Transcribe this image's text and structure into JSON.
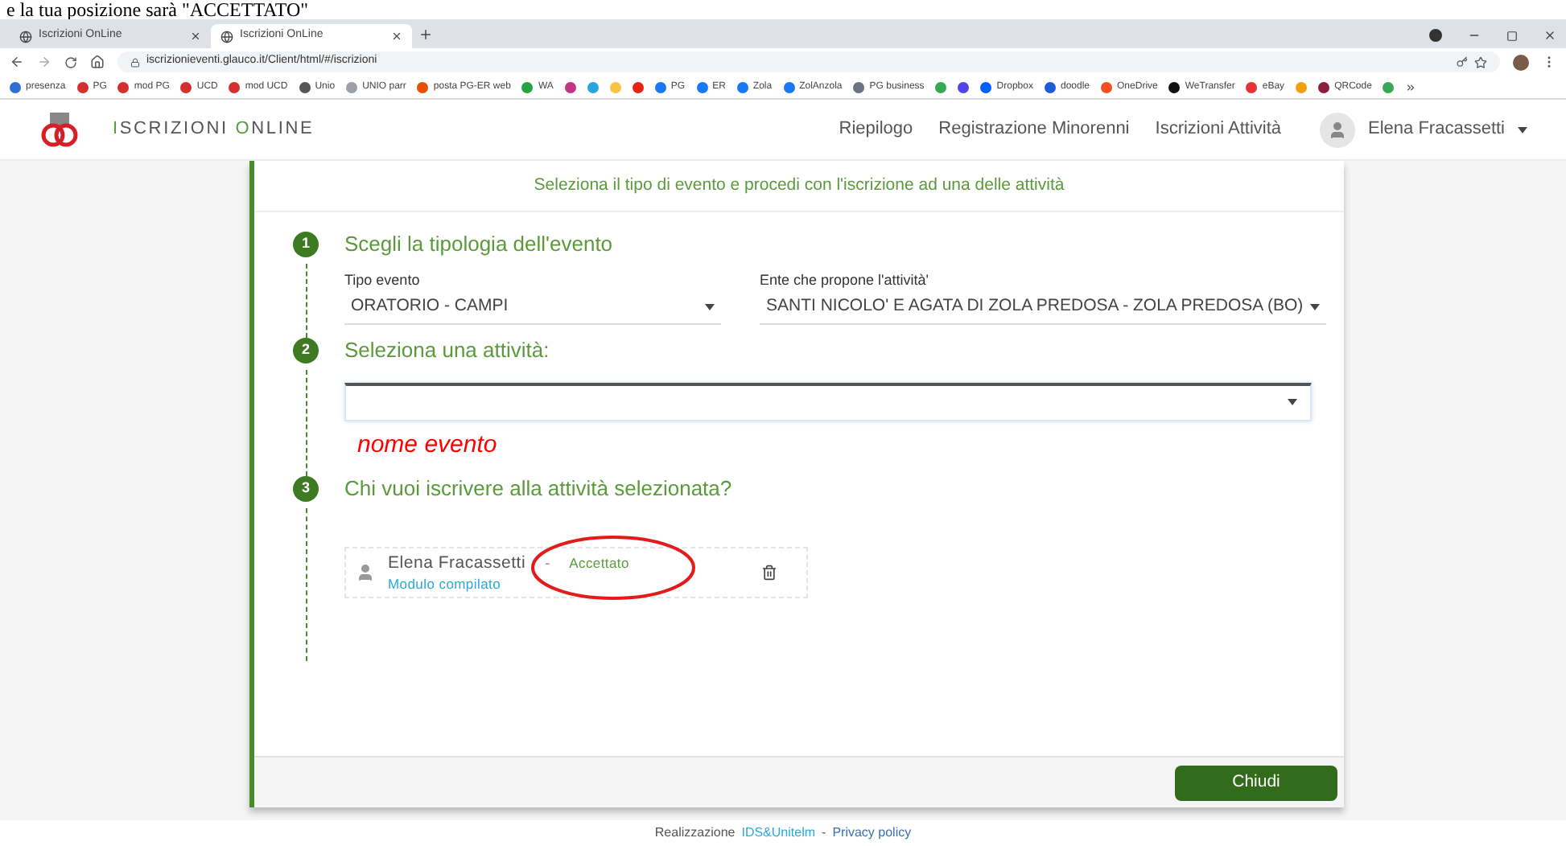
{
  "caption": "e la tua posizione sarà \"ACCETTATO\"",
  "browser": {
    "tabs": [
      {
        "title": "Iscrizioni OnLine",
        "selected": false
      },
      {
        "title": "Iscrizioni OnLine",
        "selected": true
      }
    ],
    "url": "iscrizionieventi.glauco.it/Client/html/#/iscrizioni",
    "bookmarks": [
      {
        "label": "presenza",
        "color": "#2f6fd1"
      },
      {
        "label": "PG",
        "color": "#d32f2f"
      },
      {
        "label": "mod PG",
        "color": "#d32f2f"
      },
      {
        "label": "UCD",
        "color": "#d32f2f"
      },
      {
        "label": "mod UCD",
        "color": "#d32f2f"
      },
      {
        "label": "Unio",
        "color": "#555555"
      },
      {
        "label": "UNIO parr",
        "color": "#9aa0a6"
      },
      {
        "label": "posta PG-ER web",
        "color": "#e65100"
      },
      {
        "label": "WA",
        "color": "#25a244"
      },
      {
        "color": "#c13584"
      },
      {
        "color": "#2aa3e0"
      },
      {
        "color": "#f6c343"
      },
      {
        "color": "#e62117"
      },
      {
        "label": "PG",
        "color": "#1877f2"
      },
      {
        "label": "ER",
        "color": "#1877f2"
      },
      {
        "label": "Zola",
        "color": "#1877f2"
      },
      {
        "label": "ZolAnzola",
        "color": "#1877f2"
      },
      {
        "label": "PG business",
        "color": "#6b7280"
      },
      {
        "color": "#34a853"
      },
      {
        "color": "#4f46e5"
      },
      {
        "label": "Dropbox",
        "color": "#0061fe"
      },
      {
        "label": "doodle",
        "color": "#1e5bd8"
      },
      {
        "label": "OneDrive",
        "color": "#f25022"
      },
      {
        "label": "WeTransfer",
        "color": "#111111"
      },
      {
        "label": "eBay",
        "color": "#e53238"
      },
      {
        "color": "#f59e0b"
      },
      {
        "label": "QRCode",
        "color": "#8b1e3f"
      },
      {
        "color": "#3aa757"
      }
    ]
  },
  "app": {
    "brand_first": "I",
    "brand_mid": "SCRIZIONI ",
    "brand_second": "O",
    "brand_rest": "NLINE",
    "nav": [
      {
        "label": "Riepilogo"
      },
      {
        "label": "Registrazione Minorenni"
      },
      {
        "label": "Iscrizioni Attività"
      }
    ],
    "user": "Elena Fracassetti"
  },
  "card": {
    "header": "Seleziona il tipo di evento e procedi con l'iscrizione ad una delle attività",
    "steps": [
      {
        "number": "1",
        "title": "Scegli la tipologia dell'evento",
        "kind": "selects",
        "fields": [
          {
            "label": "Tipo evento",
            "value": "ORATORIO - CAMPI"
          },
          {
            "label": "Ente che propone l'attività'",
            "value": "SANTI NICOLO' E AGATA DI ZOLA PREDOSA - ZOLA PREDOSA (BO)"
          }
        ]
      },
      {
        "number": "2",
        "title": "Seleziona una attività:",
        "kind": "activity",
        "note": "nome evento"
      },
      {
        "number": "3",
        "title": "Chi vuoi iscrivere alla attività selezionata?",
        "kind": "people",
        "people": [
          {
            "name": "Elena Fracassetti",
            "separator": "-",
            "status": "Accettato",
            "form": "Modulo compilato"
          }
        ]
      }
    ],
    "button": "Chiudi"
  },
  "footer": {
    "prefix": "Realizzazione",
    "link1": "IDS&Unitelm",
    "separator": "-",
    "link2": "Privacy policy"
  }
}
